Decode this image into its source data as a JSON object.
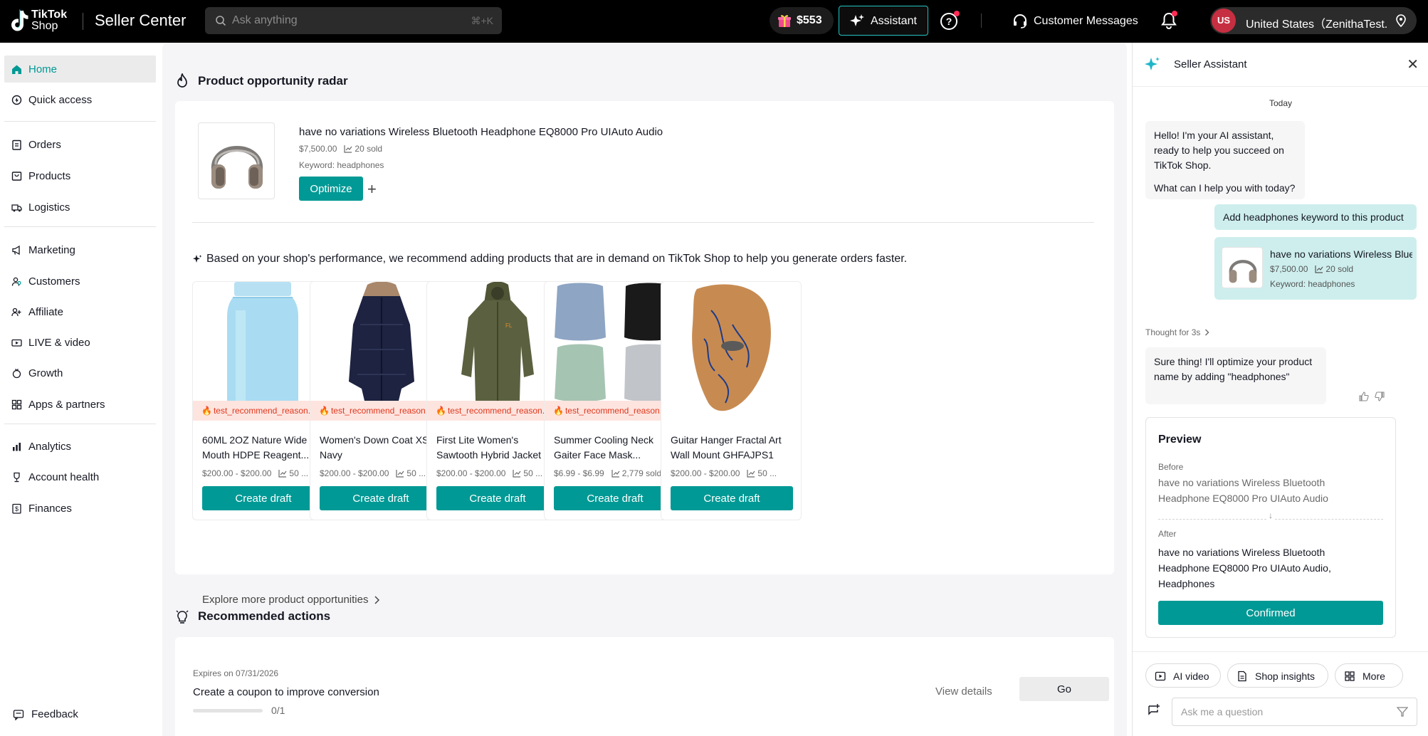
{
  "header": {
    "logo_line1": "TikTok",
    "logo_line2": "Shop",
    "app_title": "Seller Center",
    "search_placeholder": "Ask anything",
    "search_shortcut": "⌘+K",
    "balance": "$553",
    "assistant_label": "Assistant",
    "customer_messages_label": "Customer Messages",
    "account_initials": "US",
    "account_label": "United States（ZenithaTest..."
  },
  "sidebar": {
    "items": [
      {
        "label": "Home",
        "icon": "home-icon",
        "active": true
      },
      {
        "label": "Quick access",
        "icon": "quick-access-icon"
      },
      {
        "label": "Orders",
        "icon": "orders-icon"
      },
      {
        "label": "Products",
        "icon": "products-icon"
      },
      {
        "label": "Logistics",
        "icon": "logistics-icon"
      },
      {
        "label": "Marketing",
        "icon": "megaphone-icon"
      },
      {
        "label": "Customers",
        "icon": "customers-icon"
      },
      {
        "label": "Affiliate",
        "icon": "affiliate-icon"
      },
      {
        "label": "LIVE & video",
        "icon": "live-video-icon"
      },
      {
        "label": "Growth",
        "icon": "growth-icon"
      },
      {
        "label": "Apps & partners",
        "icon": "apps-icon"
      },
      {
        "label": "Analytics",
        "icon": "analytics-icon"
      },
      {
        "label": "Account health",
        "icon": "trophy-icon"
      },
      {
        "label": "Finances",
        "icon": "finances-icon"
      }
    ],
    "feedback_label": "Feedback"
  },
  "main": {
    "radar_title": "Product opportunity radar",
    "product": {
      "name": "have no variations Wireless Bluetooth Headphone EQ8000 Pro UIAuto Audio",
      "price": "$7,500.00",
      "sold": "20 sold",
      "keyword": "Keyword: headphones",
      "optimize_label": "Optimize"
    },
    "recommendation_text": "Based on your shop's performance, we recommend adding products that are in demand on TikTok Shop to help you generate orders faster.",
    "products": [
      {
        "tag": "test_recommend_reason...",
        "name": "60ML 2OZ Nature Wide Mouth HDPE Reagent...",
        "price": "$200.00 - $200.00",
        "sold": "50 ...",
        "button": "Create draft"
      },
      {
        "tag": "test_recommend_reason...",
        "name": "Women's Down Coat XS Navy",
        "price": "$200.00 - $200.00",
        "sold": "50 ...",
        "button": "Create draft"
      },
      {
        "tag": "test_recommend_reason...",
        "name": "First Lite Women's Sawtooth Hybrid Jacket",
        "price": "$200.00 - $200.00",
        "sold": "50 ...",
        "button": "Create draft"
      },
      {
        "tag": "test_recommend_reason...",
        "name": "Summer Cooling Neck Gaiter Face Mask...",
        "price": "$6.99 - $6.99",
        "sold": "2,779 sold",
        "button": "Create draft"
      },
      {
        "tag": "",
        "name": "Guitar Hanger Fractal Art Wall Mount GHFAJPS1",
        "price": "$200.00 - $200.00",
        "sold": "50 ...",
        "button": "Create draft"
      }
    ],
    "explore_label": "Explore more product opportunities",
    "recommended_actions_title": "Recommended actions",
    "action": {
      "expires": "Expires on 07/31/2026",
      "title": "Create a coupon to improve conversion",
      "progress_text": "0/1",
      "progress_fraction": 0,
      "view_details": "View details",
      "go_label": "Go"
    }
  },
  "assistant": {
    "title": "Seller Assistant",
    "date_label": "Today",
    "greeting_line1": "Hello! I'm your AI assistant, ready to help you succeed on TikTok Shop.",
    "greeting_line2": "What can I help you with today?",
    "user_message": "Add headphones keyword to this product",
    "card_name": "have no variations Wireless Bluetoo...",
    "card_price": "$7,500.00",
    "card_sold": "20 sold",
    "card_keyword": "Keyword: headphones",
    "thought_label": "Thought for 3s",
    "reply": "Sure thing! I'll optimize your product name by adding \"headphones\"",
    "preview_title": "Preview",
    "before_label": "Before",
    "before_text": "have no variations Wireless Bluetooth Headphone EQ8000 Pro UIAuto Audio",
    "after_label": "After",
    "after_text": "have no variations Wireless Bluetooth Headphone EQ8000 Pro UIAuto Audio, Headphones",
    "confirmed_label": "Confirmed",
    "chips": [
      "AI video",
      "Shop insights",
      "More"
    ],
    "ask_placeholder": "Ask me a question"
  },
  "colors": {
    "accent": "#009995",
    "topbar": "#000000",
    "user_bubble": "#cdeeed",
    "tag_bg": "#fde4df",
    "tag_text": "#e0371c",
    "alert": "#fe2c55"
  }
}
